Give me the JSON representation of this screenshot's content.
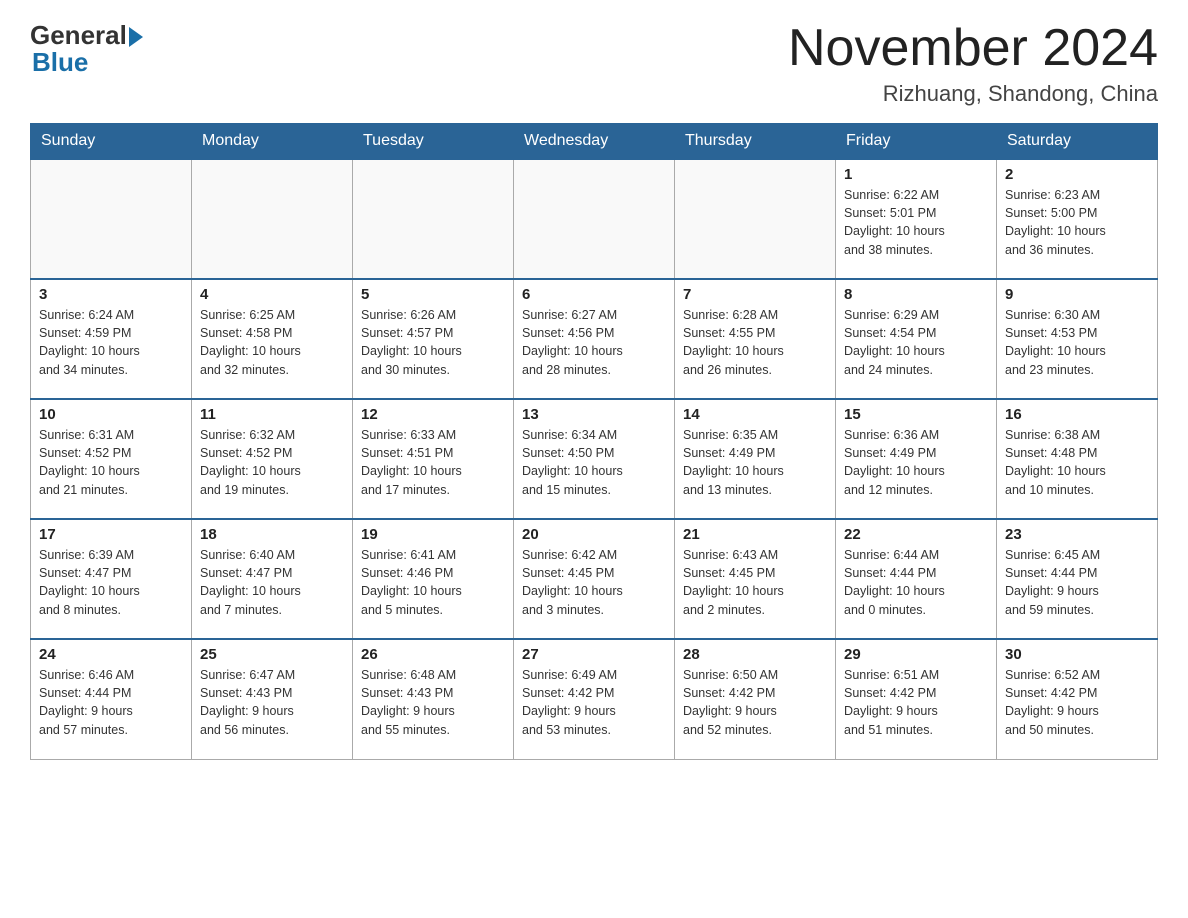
{
  "header": {
    "logo_general": "General",
    "logo_blue": "Blue",
    "month_title": "November 2024",
    "location": "Rizhuang, Shandong, China"
  },
  "weekdays": [
    "Sunday",
    "Monday",
    "Tuesday",
    "Wednesday",
    "Thursday",
    "Friday",
    "Saturday"
  ],
  "weeks": [
    [
      {
        "day": "",
        "info": ""
      },
      {
        "day": "",
        "info": ""
      },
      {
        "day": "",
        "info": ""
      },
      {
        "day": "",
        "info": ""
      },
      {
        "day": "",
        "info": ""
      },
      {
        "day": "1",
        "info": "Sunrise: 6:22 AM\nSunset: 5:01 PM\nDaylight: 10 hours\nand 38 minutes."
      },
      {
        "day": "2",
        "info": "Sunrise: 6:23 AM\nSunset: 5:00 PM\nDaylight: 10 hours\nand 36 minutes."
      }
    ],
    [
      {
        "day": "3",
        "info": "Sunrise: 6:24 AM\nSunset: 4:59 PM\nDaylight: 10 hours\nand 34 minutes."
      },
      {
        "day": "4",
        "info": "Sunrise: 6:25 AM\nSunset: 4:58 PM\nDaylight: 10 hours\nand 32 minutes."
      },
      {
        "day": "5",
        "info": "Sunrise: 6:26 AM\nSunset: 4:57 PM\nDaylight: 10 hours\nand 30 minutes."
      },
      {
        "day": "6",
        "info": "Sunrise: 6:27 AM\nSunset: 4:56 PM\nDaylight: 10 hours\nand 28 minutes."
      },
      {
        "day": "7",
        "info": "Sunrise: 6:28 AM\nSunset: 4:55 PM\nDaylight: 10 hours\nand 26 minutes."
      },
      {
        "day": "8",
        "info": "Sunrise: 6:29 AM\nSunset: 4:54 PM\nDaylight: 10 hours\nand 24 minutes."
      },
      {
        "day": "9",
        "info": "Sunrise: 6:30 AM\nSunset: 4:53 PM\nDaylight: 10 hours\nand 23 minutes."
      }
    ],
    [
      {
        "day": "10",
        "info": "Sunrise: 6:31 AM\nSunset: 4:52 PM\nDaylight: 10 hours\nand 21 minutes."
      },
      {
        "day": "11",
        "info": "Sunrise: 6:32 AM\nSunset: 4:52 PM\nDaylight: 10 hours\nand 19 minutes."
      },
      {
        "day": "12",
        "info": "Sunrise: 6:33 AM\nSunset: 4:51 PM\nDaylight: 10 hours\nand 17 minutes."
      },
      {
        "day": "13",
        "info": "Sunrise: 6:34 AM\nSunset: 4:50 PM\nDaylight: 10 hours\nand 15 minutes."
      },
      {
        "day": "14",
        "info": "Sunrise: 6:35 AM\nSunset: 4:49 PM\nDaylight: 10 hours\nand 13 minutes."
      },
      {
        "day": "15",
        "info": "Sunrise: 6:36 AM\nSunset: 4:49 PM\nDaylight: 10 hours\nand 12 minutes."
      },
      {
        "day": "16",
        "info": "Sunrise: 6:38 AM\nSunset: 4:48 PM\nDaylight: 10 hours\nand 10 minutes."
      }
    ],
    [
      {
        "day": "17",
        "info": "Sunrise: 6:39 AM\nSunset: 4:47 PM\nDaylight: 10 hours\nand 8 minutes."
      },
      {
        "day": "18",
        "info": "Sunrise: 6:40 AM\nSunset: 4:47 PM\nDaylight: 10 hours\nand 7 minutes."
      },
      {
        "day": "19",
        "info": "Sunrise: 6:41 AM\nSunset: 4:46 PM\nDaylight: 10 hours\nand 5 minutes."
      },
      {
        "day": "20",
        "info": "Sunrise: 6:42 AM\nSunset: 4:45 PM\nDaylight: 10 hours\nand 3 minutes."
      },
      {
        "day": "21",
        "info": "Sunrise: 6:43 AM\nSunset: 4:45 PM\nDaylight: 10 hours\nand 2 minutes."
      },
      {
        "day": "22",
        "info": "Sunrise: 6:44 AM\nSunset: 4:44 PM\nDaylight: 10 hours\nand 0 minutes."
      },
      {
        "day": "23",
        "info": "Sunrise: 6:45 AM\nSunset: 4:44 PM\nDaylight: 9 hours\nand 59 minutes."
      }
    ],
    [
      {
        "day": "24",
        "info": "Sunrise: 6:46 AM\nSunset: 4:44 PM\nDaylight: 9 hours\nand 57 minutes."
      },
      {
        "day": "25",
        "info": "Sunrise: 6:47 AM\nSunset: 4:43 PM\nDaylight: 9 hours\nand 56 minutes."
      },
      {
        "day": "26",
        "info": "Sunrise: 6:48 AM\nSunset: 4:43 PM\nDaylight: 9 hours\nand 55 minutes."
      },
      {
        "day": "27",
        "info": "Sunrise: 6:49 AM\nSunset: 4:42 PM\nDaylight: 9 hours\nand 53 minutes."
      },
      {
        "day": "28",
        "info": "Sunrise: 6:50 AM\nSunset: 4:42 PM\nDaylight: 9 hours\nand 52 minutes."
      },
      {
        "day": "29",
        "info": "Sunrise: 6:51 AM\nSunset: 4:42 PM\nDaylight: 9 hours\nand 51 minutes."
      },
      {
        "day": "30",
        "info": "Sunrise: 6:52 AM\nSunset: 4:42 PM\nDaylight: 9 hours\nand 50 minutes."
      }
    ]
  ]
}
